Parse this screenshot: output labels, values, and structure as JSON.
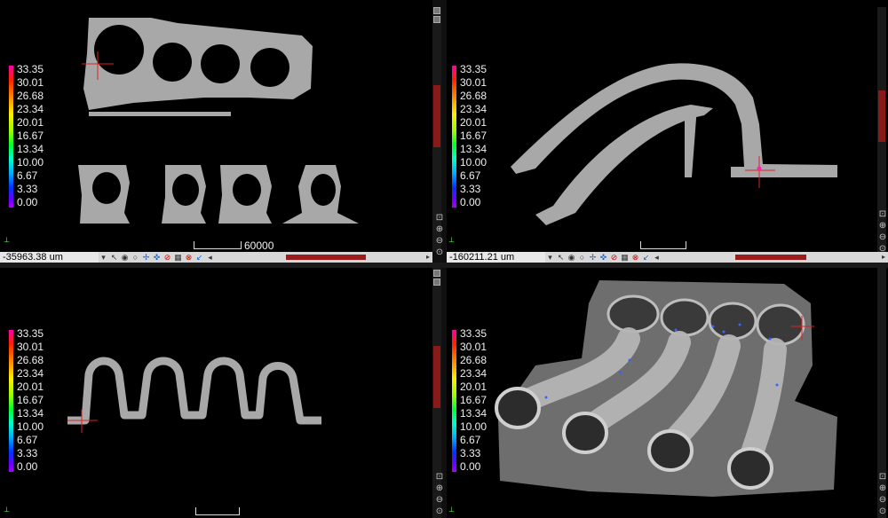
{
  "legend": {
    "labels": [
      "33.35",
      "30.01",
      "26.68",
      "23.34",
      "20.01",
      "16.67",
      "13.34",
      "10.00",
      "6.67",
      "3.33",
      "0.00"
    ]
  },
  "panes": {
    "top_left": {
      "coord": "-35963.38 um",
      "scale_label": "60000"
    },
    "top_right": {
      "coord": "-160211.21 um"
    },
    "bottom_left": {},
    "bottom_right": {}
  },
  "colors": {
    "part_gray": "#a8a8a8",
    "measurement_red": "#dd2222",
    "scroll_thumb": "#8a1a1a"
  },
  "icons": [
    "dropdown-arrow-icon",
    "pointer-icon",
    "eye-icon",
    "circle-icon",
    "measure-icon",
    "axis-icon",
    "slice-icon",
    "grid-icon",
    "ruler-icon",
    "color-icon",
    "arrow-left-icon",
    "arrow-right-icon"
  ]
}
